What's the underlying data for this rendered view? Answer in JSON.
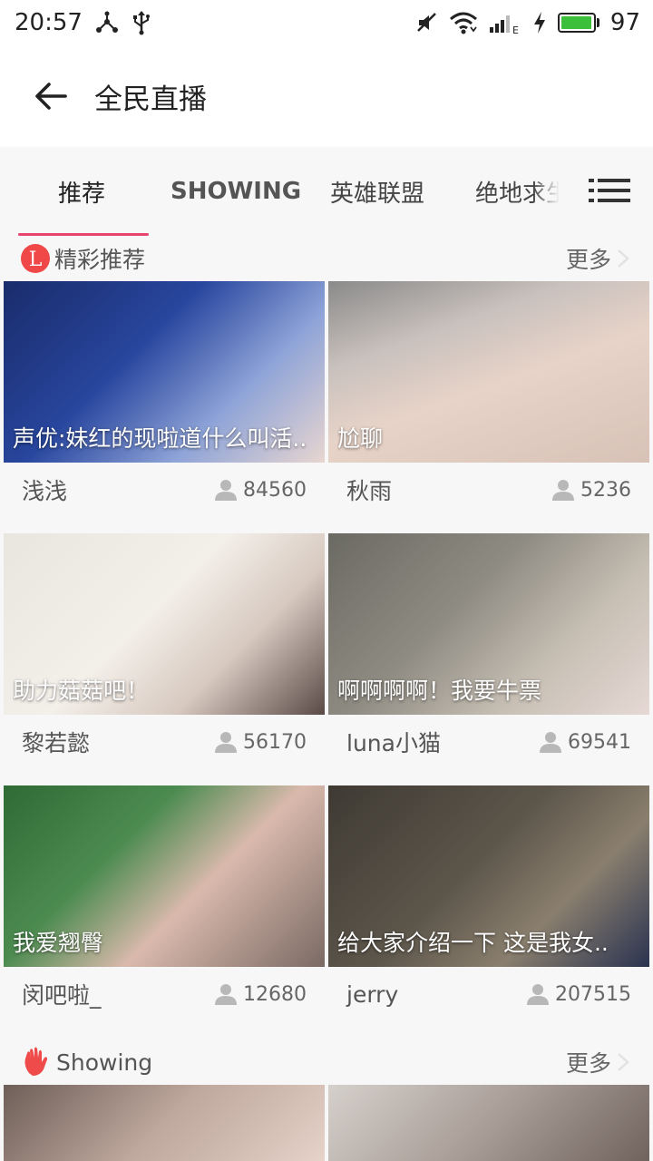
{
  "status_bar": {
    "time": "20:57",
    "battery_level": "97",
    "battery_fraction": 0.97
  },
  "header": {
    "title": "全民直播"
  },
  "tabs": [
    {
      "label": "推荐"
    },
    {
      "label": "SHOWING"
    },
    {
      "label": "英雄联盟"
    },
    {
      "label": "绝地求生"
    }
  ],
  "sections": [
    {
      "title": "精彩推荐",
      "more_label": "更多",
      "cards": [
        {
          "caption": "声优:妹红的现啦道什么叫活..",
          "streamer": "浅浅",
          "viewers": "84560"
        },
        {
          "caption": "尬聊",
          "streamer": "秋雨",
          "viewers": "5236"
        },
        {
          "caption": "助力菇菇吧！",
          "streamer": "黎若懿",
          "viewers": "56170"
        },
        {
          "caption": "啊啊啊啊！我要牛票",
          "streamer": "luna小猫",
          "viewers": "69541"
        },
        {
          "caption": "我爱翘臀",
          "streamer": "闵吧啦_",
          "viewers": "12680"
        },
        {
          "caption": "给大家介绍一下 这是我女..",
          "streamer": "jerry",
          "viewers": "207515"
        }
      ]
    },
    {
      "title": "Showing",
      "more_label": "更多"
    }
  ],
  "colors": {
    "accent": "#e8436f",
    "text_primary": "#222222",
    "text_secondary": "#555555",
    "icon_gray": "#b8b8b8"
  }
}
